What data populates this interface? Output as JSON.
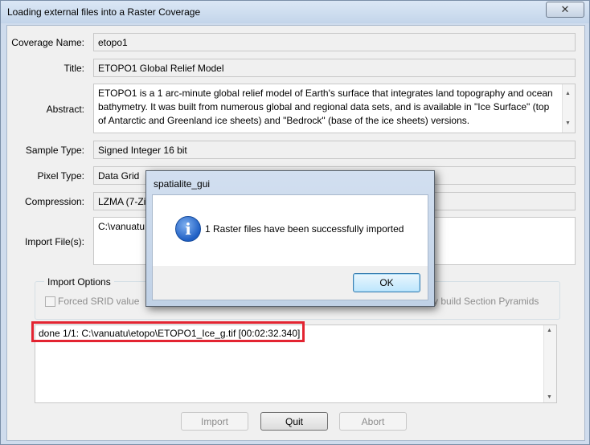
{
  "window": {
    "title": "Loading external files into a Raster Coverage",
    "close_glyph": "✕"
  },
  "form": {
    "coverage_name": {
      "label": "Coverage Name:",
      "value": "etopo1"
    },
    "title": {
      "label": "Title:",
      "value": "ETOPO1 Global Relief Model"
    },
    "abstract": {
      "label": "Abstract:",
      "value": "ETOPO1 is a 1 arc-minute global relief model of Earth's surface that integrates land topography and ocean bathymetry. It was built from numerous global and regional data sets, and is available in \"Ice Surface\" (top of Antarctic and Greenland ice sheets) and \"Bedrock\" (base of the ice sheets) versions."
    },
    "sample_type": {
      "label": "Sample Type:",
      "value": "Signed Integer 16 bit"
    },
    "pixel_type": {
      "label": "Pixel Type:",
      "value": "Data Grid"
    },
    "compression": {
      "label": "Compression:",
      "value": "LZMA (7-Zi"
    },
    "import_files": {
      "label": "Import File(s):",
      "value": "C:\\vanuatu"
    }
  },
  "import_options": {
    "label": "Import Options",
    "forced_srid": "Forced SRID value",
    "pyramids": "y build Section Pyramids"
  },
  "log": {
    "line": "done 1/1: C:\\vanuatu\\etopo\\ETOPO1_Ice_g.tif    [00:02:32.340]"
  },
  "buttons": {
    "import": "Import",
    "quit": "Quit",
    "abort": "Abort"
  },
  "dialog": {
    "title": "spatialite_gui",
    "icon": "information-icon",
    "icon_glyph": "i",
    "message": "1 Raster files have been successfully imported",
    "ok": "OK"
  },
  "colors": {
    "highlight": "#e32431",
    "titlebar": "#c9d9ec"
  }
}
